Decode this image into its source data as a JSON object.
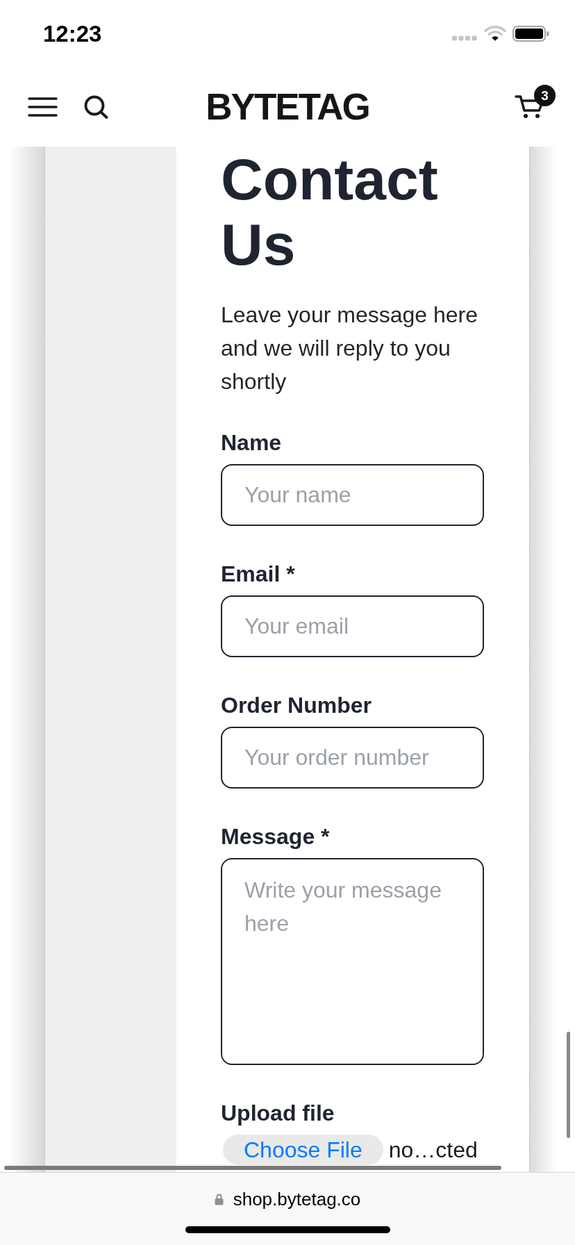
{
  "status_bar": {
    "time": "12:23"
  },
  "header": {
    "logo": "BYTETAG",
    "cart_count": "3"
  },
  "page": {
    "title": "Contact Us",
    "intro": "Leave your message here and we will reply to you shortly",
    "fields": [
      {
        "kind": "input",
        "label": "Name",
        "placeholder": "Your name"
      },
      {
        "kind": "input",
        "label": "Email *",
        "placeholder": "Your email"
      },
      {
        "kind": "input",
        "label": "Order Number",
        "placeholder": "Your order number"
      },
      {
        "kind": "textarea",
        "label": "Message *",
        "placeholder": "Write your message here"
      },
      {
        "kind": "file",
        "label": "Upload file",
        "button": "Choose File",
        "file_status": "no…cted"
      }
    ]
  },
  "browser_bar": {
    "url": "shop.bytetag.co"
  }
}
